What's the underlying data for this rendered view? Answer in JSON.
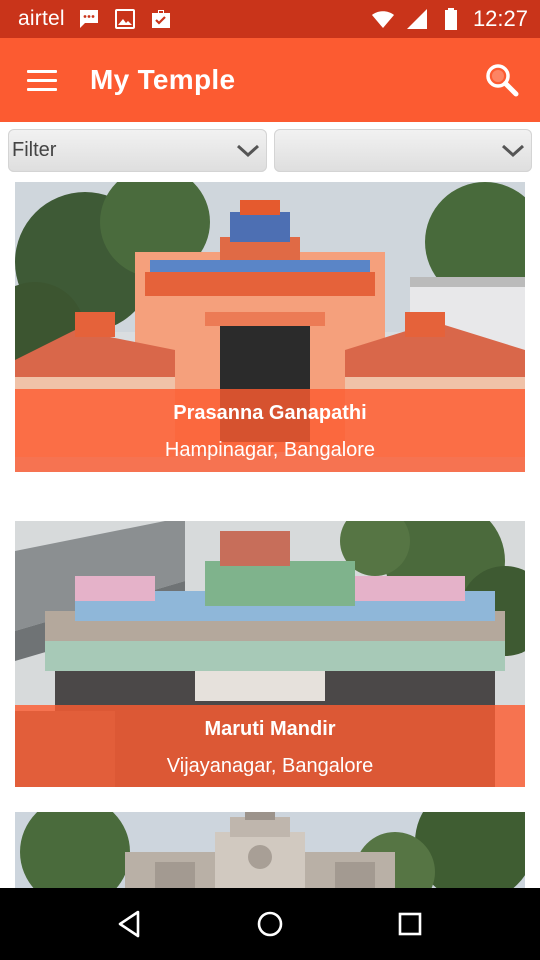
{
  "status_bar": {
    "carrier": "airtel",
    "time": "12:27",
    "icons": [
      "message-icon",
      "image-icon",
      "briefcase-check-icon",
      "wifi-icon",
      "signal-icon",
      "battery-icon"
    ]
  },
  "app_bar": {
    "title": "My Temple",
    "menu_icon": "hamburger-menu-icon",
    "search_icon": "search-icon",
    "color": "#fc5b31"
  },
  "filters": {
    "primary": {
      "selected": "Filter"
    },
    "secondary": {
      "selected": ""
    }
  },
  "temples": [
    {
      "name": "Prasanna Ganapathi",
      "location": "Hampinagar, Bangalore"
    },
    {
      "name": "Maruti Mandir",
      "location": "Vijayanagar, Bangalore"
    },
    {
      "name": "",
      "location": ""
    }
  ],
  "nav_bar": {
    "icons": [
      "back-icon",
      "home-icon",
      "recents-icon"
    ]
  },
  "colors": {
    "status_bar": "#c9341a",
    "accent": "#fc5b31",
    "nav_bar": "#000000"
  }
}
